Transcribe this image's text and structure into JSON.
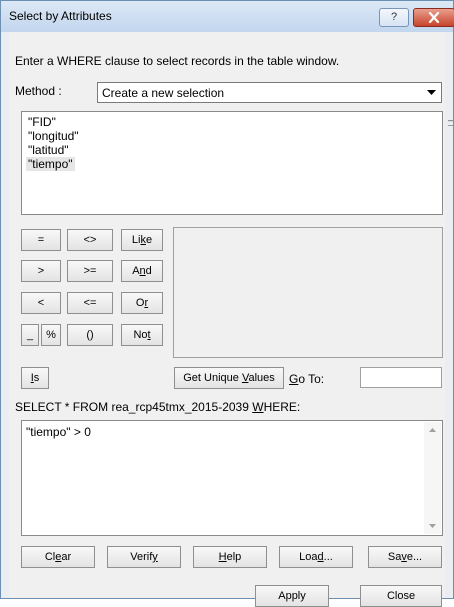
{
  "title": "Select by Attributes",
  "title_buttons": {
    "help": "?",
    "close_icon": "close-icon"
  },
  "instruction": "Enter a WHERE clause to select records in the table window.",
  "method": {
    "label": "Method :",
    "value": "Create a new selection"
  },
  "fields": [
    "\"FID\"",
    "\"longitud\"",
    "\"latitud\"",
    "\"tiempo\""
  ],
  "selected_field_index": 3,
  "operators": {
    "eq": "=",
    "ne": "<>",
    "like": "Like",
    "gt": ">",
    "ge": ">=",
    "and": "And",
    "lt": "<",
    "le": "<=",
    "or": "Or",
    "underscore": "_",
    "percent": "%",
    "parens": "()",
    "not": "Not",
    "is": "Is"
  },
  "get_unique_values": "Get Unique Values",
  "goto_label": "Go To:",
  "goto_value": "",
  "select_clause": "SELECT * FROM rea_rcp45tmx_2015-2039 WHERE:",
  "expression": "\"tiempo\" > 0",
  "bottom_buttons": {
    "clear": "Clear",
    "verify": "Verify",
    "help": "Help",
    "load": "Load...",
    "save": "Save..."
  },
  "dialog_buttons": {
    "apply": "Apply",
    "close": "Close"
  }
}
